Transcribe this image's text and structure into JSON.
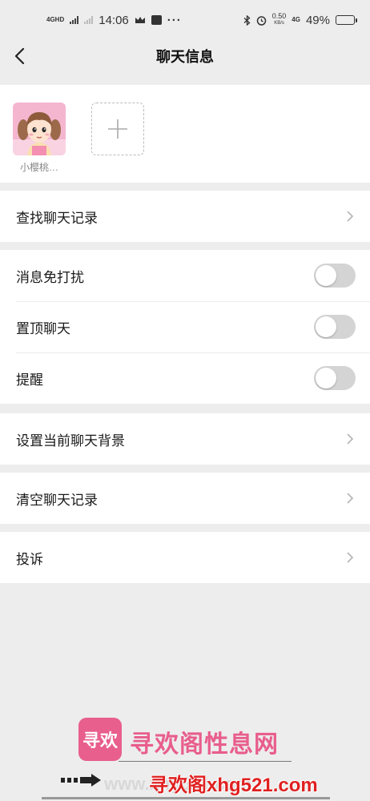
{
  "status_bar": {
    "net1_tag": "4GHD",
    "time": "14:06",
    "dots": "···",
    "speed_value": "0.50",
    "speed_unit": "KB/s",
    "net2_tag": "4G",
    "battery_percent": "49%",
    "battery_level": 0.49
  },
  "nav": {
    "title": "聊天信息"
  },
  "members": [
    {
      "name": "小樱桃…"
    }
  ],
  "menu": {
    "search_history": "查找聊天记录",
    "mute": "消息免打扰",
    "pin": "置顶聊天",
    "remind": "提醒",
    "set_background": "设置当前聊天背景",
    "clear_history": "清空聊天记录",
    "complain": "投诉"
  },
  "toggles": {
    "mute_on": false,
    "pin_on": false,
    "remind_on": false
  },
  "watermark": {
    "logo_text": "寻欢",
    "title": "寻欢阁性息网",
    "url": "寻欢阁xhg521.com",
    "shadow_text": "www.xhg521.com"
  },
  "colors": {
    "background": "#ededed",
    "toggle_off": "#d4d4d4",
    "watermark_pink": "#e85e8c",
    "watermark_red": "#e02020"
  }
}
